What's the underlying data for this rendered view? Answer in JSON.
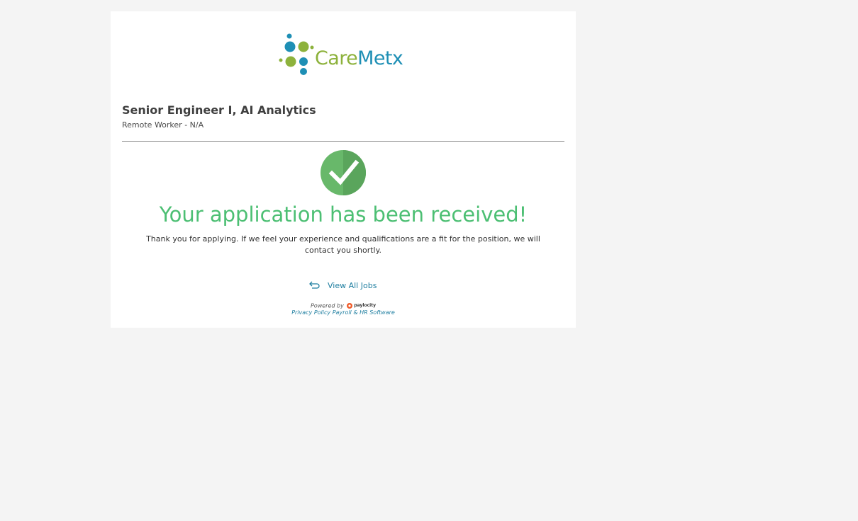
{
  "brand": {
    "logo_part1": "Care",
    "logo_part2": "Metx",
    "colors": {
      "green": "#8db23c",
      "blue": "#1e8fb5"
    }
  },
  "job": {
    "title": "Senior Engineer I, AI Analytics",
    "location": "Remote Worker - N/A"
  },
  "confirmation": {
    "icon": "checkmark-circle-icon",
    "heading": "Your application has been received!",
    "message": "Thank you for applying. If we feel your experience and qualifications are a fit for the position, we will contact you shortly.",
    "heading_color": "#4cbf73"
  },
  "actions": {
    "view_all_jobs": "View All Jobs",
    "view_all_jobs_icon": "return-arrow-icon"
  },
  "footer": {
    "powered_by": "Powered by",
    "paylocity_logo": "paylocity",
    "privacy_policy": "Privacy Policy",
    "payroll_hr": "Payroll & HR Software"
  }
}
